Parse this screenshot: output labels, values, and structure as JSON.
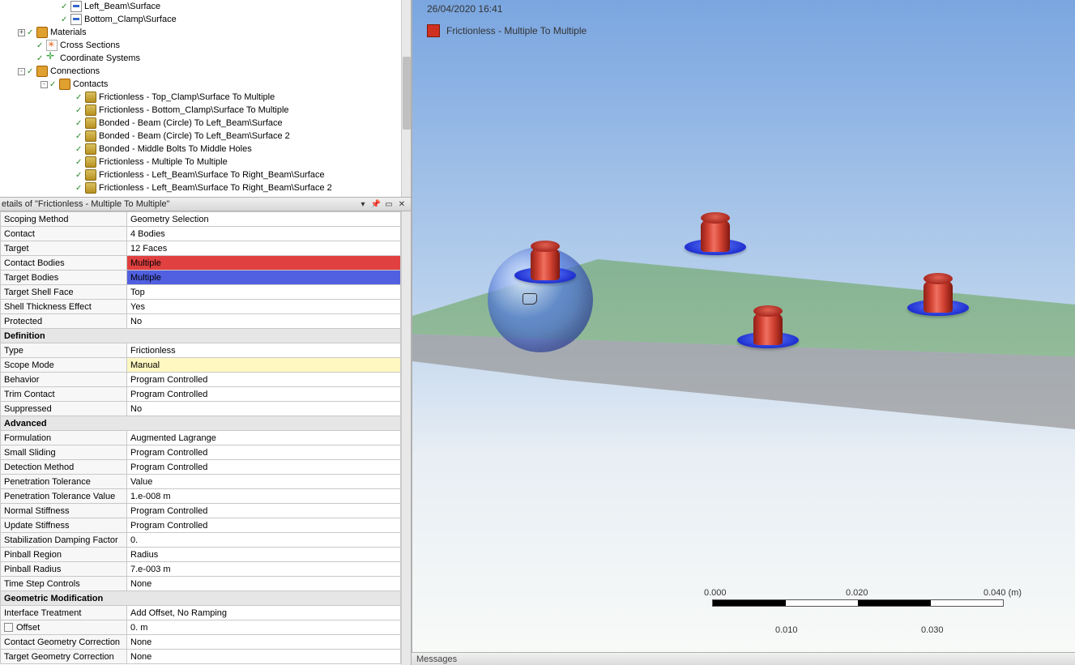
{
  "tree": {
    "items": [
      {
        "indent": 62,
        "icon": "surf",
        "tick": true,
        "label": "Left_Beam\\Surface"
      },
      {
        "indent": 62,
        "icon": "surf",
        "tick": true,
        "label": "Bottom_Clamp\\Surface"
      },
      {
        "indent": 20,
        "expander": "+",
        "icon": "mat",
        "tick": true,
        "label": "Materials"
      },
      {
        "indent": 32,
        "icon": "cs",
        "tick": true,
        "label": "Cross Sections"
      },
      {
        "indent": 32,
        "icon": "axes",
        "tick": true,
        "label": "Coordinate Systems"
      },
      {
        "indent": 20,
        "expander": "-",
        "icon": "mat",
        "tick": true,
        "label": "Connections"
      },
      {
        "indent": 48,
        "expander": "-",
        "icon": "mat",
        "tick": true,
        "label": "Contacts"
      },
      {
        "indent": 80,
        "icon": "node",
        "tick": true,
        "label": "Frictionless - Top_Clamp\\Surface To Multiple"
      },
      {
        "indent": 80,
        "icon": "node",
        "tick": true,
        "label": "Frictionless - Bottom_Clamp\\Surface To Multiple"
      },
      {
        "indent": 80,
        "icon": "node",
        "tick": true,
        "label": "Bonded - Beam (Circle) To Left_Beam\\Surface"
      },
      {
        "indent": 80,
        "icon": "node",
        "tick": true,
        "label": "Bonded - Beam (Circle) To Left_Beam\\Surface 2"
      },
      {
        "indent": 80,
        "icon": "node",
        "tick": true,
        "label": "Bonded - Middle Bolts To Middle Holes"
      },
      {
        "indent": 80,
        "icon": "node",
        "tick": true,
        "label": "Frictionless - Multiple To Multiple"
      },
      {
        "indent": 80,
        "icon": "node",
        "tick": true,
        "label": "Frictionless - Left_Beam\\Surface To Right_Beam\\Surface"
      },
      {
        "indent": 80,
        "icon": "node",
        "tick": true,
        "label": "Frictionless - Left_Beam\\Surface To Right_Beam\\Surface 2"
      }
    ]
  },
  "details_header": "etails of \"Frictionless - Multiple To Multiple\"",
  "header_symbols": {
    "dropdown": "▾",
    "pin": "📌",
    "window": "▭",
    "close": "✕"
  },
  "properties": [
    {
      "k": "Scoping Method",
      "v": "Geometry Selection"
    },
    {
      "k": "Contact",
      "v": "4 Bodies"
    },
    {
      "k": "Target",
      "v": "12 Faces"
    },
    {
      "k": "Contact Bodies",
      "v": "Multiple",
      "cls": "val-red"
    },
    {
      "k": "Target Bodies",
      "v": "Multiple",
      "cls": "val-blue"
    },
    {
      "k": "Target Shell Face",
      "v": "Top"
    },
    {
      "k": "Shell Thickness Effect",
      "v": "Yes"
    },
    {
      "k": "Protected",
      "v": "No"
    },
    {
      "group": "Definition"
    },
    {
      "k": "Type",
      "v": "Frictionless"
    },
    {
      "k": "Scope Mode",
      "v": "Manual",
      "cls": "val-yellow"
    },
    {
      "k": "Behavior",
      "v": "Program Controlled"
    },
    {
      "k": "Trim Contact",
      "v": "Program Controlled"
    },
    {
      "k": "Suppressed",
      "v": "No"
    },
    {
      "group": "Advanced"
    },
    {
      "k": "Formulation",
      "v": "Augmented Lagrange"
    },
    {
      "k": "Small Sliding",
      "v": "Program Controlled"
    },
    {
      "k": "Detection Method",
      "v": "Program Controlled"
    },
    {
      "k": "Penetration Tolerance",
      "v": "Value"
    },
    {
      "k": "Penetration Tolerance Value",
      "v": "1.e-008 m"
    },
    {
      "k": "Normal Stiffness",
      "v": "Program Controlled"
    },
    {
      "k": "Update Stiffness",
      "v": "Program Controlled"
    },
    {
      "k": "Stabilization Damping Factor",
      "v": "0."
    },
    {
      "k": "Pinball Region",
      "v": "Radius"
    },
    {
      "k": "Pinball Radius",
      "v": "7.e-003 m"
    },
    {
      "k": "Time Step Controls",
      "v": "None"
    },
    {
      "group": "Geometric Modification"
    },
    {
      "k": "Interface Treatment",
      "v": "Add Offset, No Ramping"
    },
    {
      "k": "Offset",
      "v": "0. m",
      "check": true
    },
    {
      "k": "Contact Geometry Correction",
      "v": "None"
    },
    {
      "k": "Target Geometry Correction",
      "v": "None"
    }
  ],
  "viewport": {
    "timestamp": "26/04/2020 16:41",
    "legend_label": "Frictionless - Multiple To Multiple",
    "scale": {
      "top": {
        "t0": "0.000",
        "t1": "0.020",
        "t2": "0.040 (m)"
      },
      "bot": {
        "t0": "0.010",
        "t1": "0.030"
      }
    }
  },
  "messages_label": "Messages"
}
